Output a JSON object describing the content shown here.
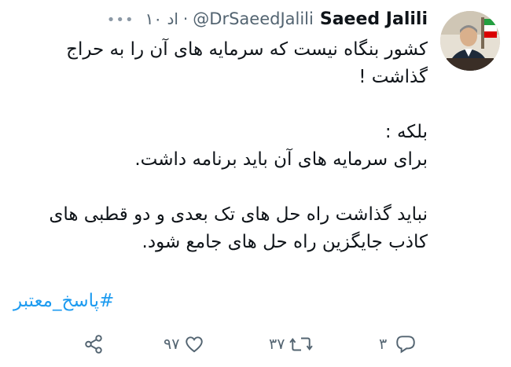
{
  "tweet": {
    "display_name": "Saeed Jalili",
    "handle": "@DrSaeedJalili",
    "separator": "·",
    "time": "۱۰ اد",
    "more": "•••",
    "body": {
      "line1": "کشور بنگاه نیست که سرمایه های آن را به حراج گذاشت !",
      "line2": "بلکه :",
      "line3": "برای سرمایه های آن باید برنامه داشت.",
      "line4": "نباید گذاشت راه حل های تک بعدی و دو قطبی های کاذب جایگزین راه حل های جامع شود."
    },
    "hashtag": "#پاسخ_معتبر"
  },
  "actions": {
    "reply": {
      "icon": "reply-icon",
      "count": "۳"
    },
    "retweet": {
      "icon": "retweet-icon",
      "count": "۳۷"
    },
    "like": {
      "icon": "heart-icon",
      "count": "۹۷"
    },
    "share": {
      "icon": "share-icon"
    }
  },
  "colors": {
    "text": "#0f1419",
    "muted": "#536471",
    "link": "#1d9bf0",
    "background": "#ffffff"
  }
}
